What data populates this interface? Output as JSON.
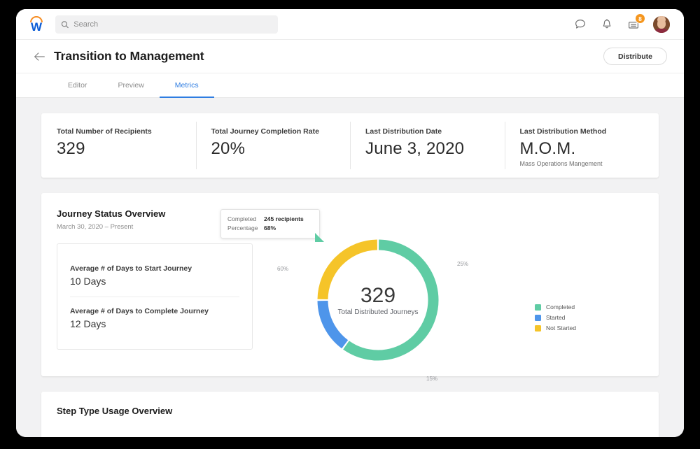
{
  "topbar": {
    "logo_name": "workday-logo",
    "search_placeholder": "Search",
    "search_value": "",
    "icons": [
      {
        "name": "chat-icon",
        "label": "Chat"
      },
      {
        "name": "bell-icon",
        "label": "Notifications"
      },
      {
        "name": "inbox-icon",
        "label": "Inbox",
        "badge": "8"
      }
    ],
    "avatar_label": "User profile"
  },
  "header": {
    "back_label": "←",
    "title": "Transition to Management",
    "distribute_label": "Distribute"
  },
  "tabs": [
    {
      "label": "Editor",
      "active": false
    },
    {
      "label": "Preview",
      "active": false
    },
    {
      "label": "Metrics",
      "active": true
    }
  ],
  "kpis": [
    {
      "label": "Total Number of Recipients",
      "value": "329",
      "sub": ""
    },
    {
      "label": "Total Journey Completion Rate",
      "value": "20%",
      "sub": ""
    },
    {
      "label": "Last Distribution Date",
      "value": "June 3, 2020",
      "sub": ""
    },
    {
      "label": "Last Distribution Method",
      "value": "M.O.M.",
      "sub": "Mass Operations Mangement"
    }
  ],
  "journey": {
    "title": "Journey Status Overview",
    "daterange": "March 30, 2020 – Present",
    "averages": [
      {
        "label": "Average # of Days to Start Journey",
        "value": "10 Days"
      },
      {
        "label": "Average # of Days to Complete Journey",
        "value": "12 Days"
      }
    ],
    "tooltip": {
      "key1": "Completed",
      "val1": "245 recipients",
      "key2": "Percentage",
      "val2": "68%"
    }
  },
  "step_section": {
    "title": "Step Type Usage Overview"
  },
  "colors": {
    "completed": "#5FCCA4",
    "started": "#4E95EA",
    "not_started": "#F5C429",
    "accent_blue": "#2f7de1",
    "badge_orange": "#F5961E",
    "logo_orange": "#F68B1F",
    "logo_blue": "#0B5CD5"
  },
  "chart_data": {
    "type": "pie",
    "title": "Journey Status Overview",
    "subtitle": "March 30, 2020 – Present",
    "center_value": "329",
    "center_label": "Total Distributed Journeys",
    "categories": [
      "Completed",
      "Started",
      "Not Started"
    ],
    "values": [
      60,
      15,
      25
    ],
    "value_labels": [
      "60%",
      "15%",
      "25%"
    ],
    "colors": [
      "#5FCCA4",
      "#4E95EA",
      "#F5C429"
    ],
    "legend_position": "right",
    "donut": true,
    "units": "percent"
  }
}
